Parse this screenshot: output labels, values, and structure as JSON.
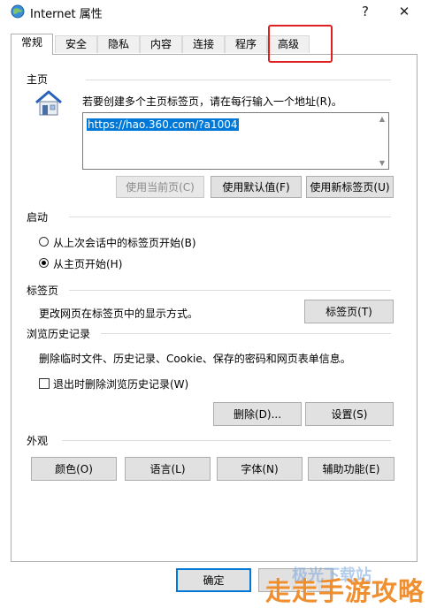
{
  "window": {
    "title": "Internet 属性",
    "help_glyph": "?",
    "close_glyph": "✕"
  },
  "tabs": [
    {
      "label": "常规"
    },
    {
      "label": "安全"
    },
    {
      "label": "隐私"
    },
    {
      "label": "内容"
    },
    {
      "label": "连接"
    },
    {
      "label": "程序"
    },
    {
      "label": "高级"
    }
  ],
  "home": {
    "section": "主页",
    "description": "若要创建多个主页标签页，请在每行输入一个地址(R)。",
    "url_value": "https://hao.360.com/?a1004",
    "btn_use_current": "使用当前页(C)",
    "btn_use_default": "使用默认值(F)",
    "btn_use_new_tab": "使用新标签页(U)"
  },
  "startup": {
    "section": "启动",
    "option_last_session": "从上次会话中的标签页开始(B)",
    "option_home_page": "从主页开始(H)",
    "selected": "option_home_page"
  },
  "tabs_section": {
    "section": "标签页",
    "description": "更改网页在标签页中的显示方式。",
    "button": "标签页(T)"
  },
  "history": {
    "section": "浏览历史记录",
    "description": "删除临时文件、历史记录、Cookie、保存的密码和网页表单信息。",
    "checkbox_label": "退出时删除浏览历史记录(W)",
    "checkbox_checked": false,
    "btn_delete": "删除(D)...",
    "btn_settings": "设置(S)"
  },
  "appearance": {
    "section": "外观",
    "btn_colors": "颜色(O)",
    "btn_languages": "语言(L)",
    "btn_fonts": "字体(N)",
    "btn_accessibility": "辅助功能(E)"
  },
  "footer": {
    "ok": "确定"
  },
  "watermark": {
    "line1": "极光下载站",
    "line2": "走走手游攻略"
  },
  "colors": {
    "accent": "#0078d7",
    "highlight_box": "#e02020"
  }
}
